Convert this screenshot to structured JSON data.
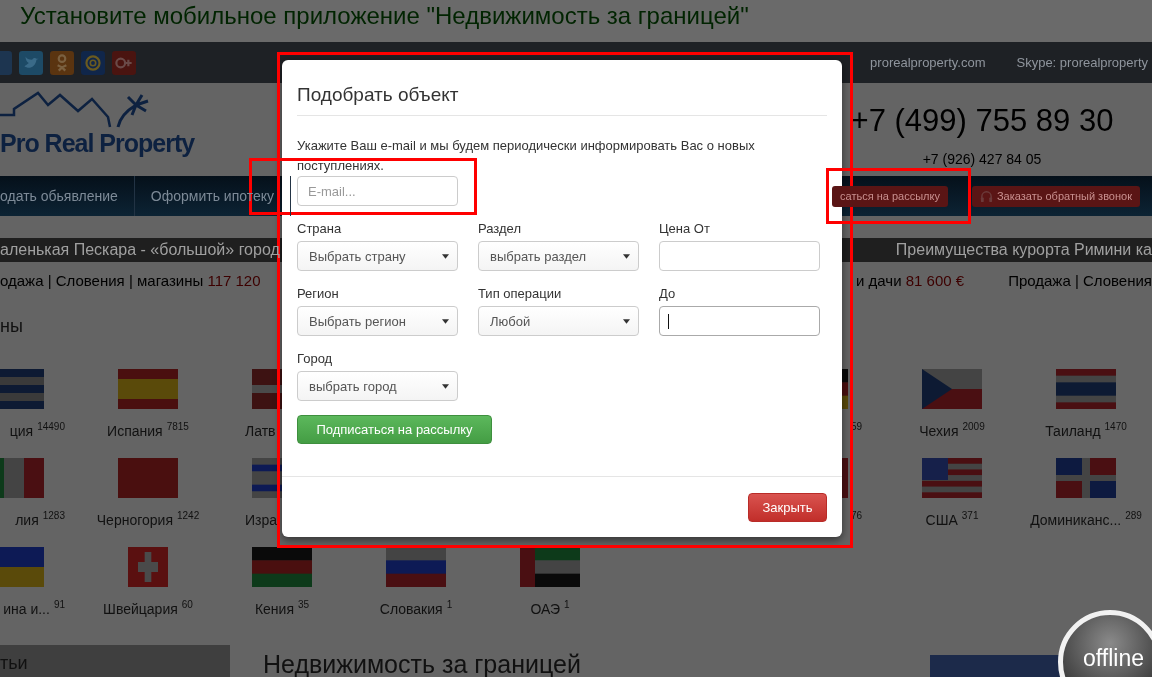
{
  "app_banner": {
    "text": "Установите мобильное приложение \"Недвижимость за границей\""
  },
  "top_bar": {
    "email": "prorealproperty.com",
    "skype": "Skype: prorealproperty"
  },
  "header": {
    "logo_text": "Pro Real Property",
    "phone_main": "+7 (499) 755 89 30",
    "phone_second": "+7 (926) 427 84 05"
  },
  "nav": {
    "items": [
      "одать обьявление",
      "Оформить ипотеку"
    ],
    "buttons": [
      {
        "label": "саться на рассылку",
        "kind": "plain"
      },
      {
        "label": "Заказать обратный звонок",
        "kind": "headset"
      }
    ]
  },
  "ticker": {
    "left": "аленькая Пескара - «большой» город",
    "right": "Преимущества курорта Римини ка"
  },
  "listings": [
    {
      "text": "одажа | Словения | магазины ",
      "price": "117 120"
    },
    {
      "text": "и дачи ",
      "price": "81 600 €"
    },
    {
      "text": "Продажа | Словения"
    }
  ],
  "section_title": "ны",
  "countries": [
    {
      "left": [
        {
          "kind": "gr",
          "name": "ция",
          "count": "14490"
        },
        {
          "kind": "es",
          "name": "Испания",
          "count": "7815"
        },
        {
          "kind": "lv",
          "name": "Латв"
        }
      ],
      "right": [
        {
          "kind": "de",
          "count": "59"
        },
        {
          "kind": "cz",
          "name": "Чехия",
          "count": "2009"
        },
        {
          "kind": "th",
          "name": "Таиланд",
          "count": "1470"
        }
      ]
    },
    {
      "left": [
        {
          "kind": "it",
          "name": "лия",
          "count": "1283"
        },
        {
          "kind": "me",
          "name": "Черногория",
          "count": "1242"
        },
        {
          "kind": "il",
          "name": "Изра"
        }
      ],
      "right": [
        {
          "kind": "red",
          "count": "76"
        },
        {
          "kind": "us",
          "name": "США",
          "count": "371"
        },
        {
          "kind": "do",
          "name": "Доминиканс...",
          "count": "289"
        }
      ]
    },
    {
      "left": [
        {
          "kind": "ua",
          "name": "ина и...",
          "count": "91"
        },
        {
          "kind": "ch",
          "name": "Швейцария",
          "count": "60"
        },
        {
          "kind": "ke",
          "name": "Кения",
          "count": "35"
        },
        {
          "kind": "sk",
          "name": "Словакия",
          "count": "1"
        },
        {
          "kind": "ae",
          "name": "ОАЭ",
          "count": "1"
        }
      ]
    }
  ],
  "sidebar_heading": "тьи",
  "main_heading": "Недвижимость за границей",
  "chat_badge": "offline",
  "modal": {
    "title": "Подобрать объект",
    "description": "Укажите Ваш e-mail и мы будем периодически информировать Вас о новых поступлениях.",
    "email": {
      "placeholder": "E-mail..."
    },
    "fields": [
      {
        "label": "Страна",
        "kind": "select",
        "value": "Выбрать страну"
      },
      {
        "label": "Раздел",
        "kind": "select",
        "value": "выбрать раздел"
      },
      {
        "label": "Цена От",
        "kind": "input",
        "focused": false
      },
      {
        "label": "Регион",
        "kind": "select",
        "value": "Выбрать регион"
      },
      {
        "label": "Тип операции",
        "kind": "select",
        "value": "Любой"
      },
      {
        "label": "До",
        "kind": "input",
        "focused": true
      },
      {
        "label": "Город",
        "kind": "select",
        "value": "выбрать город"
      }
    ],
    "subscribe_button": "Подписаться на рассылку",
    "close_button": "Закрыть"
  }
}
